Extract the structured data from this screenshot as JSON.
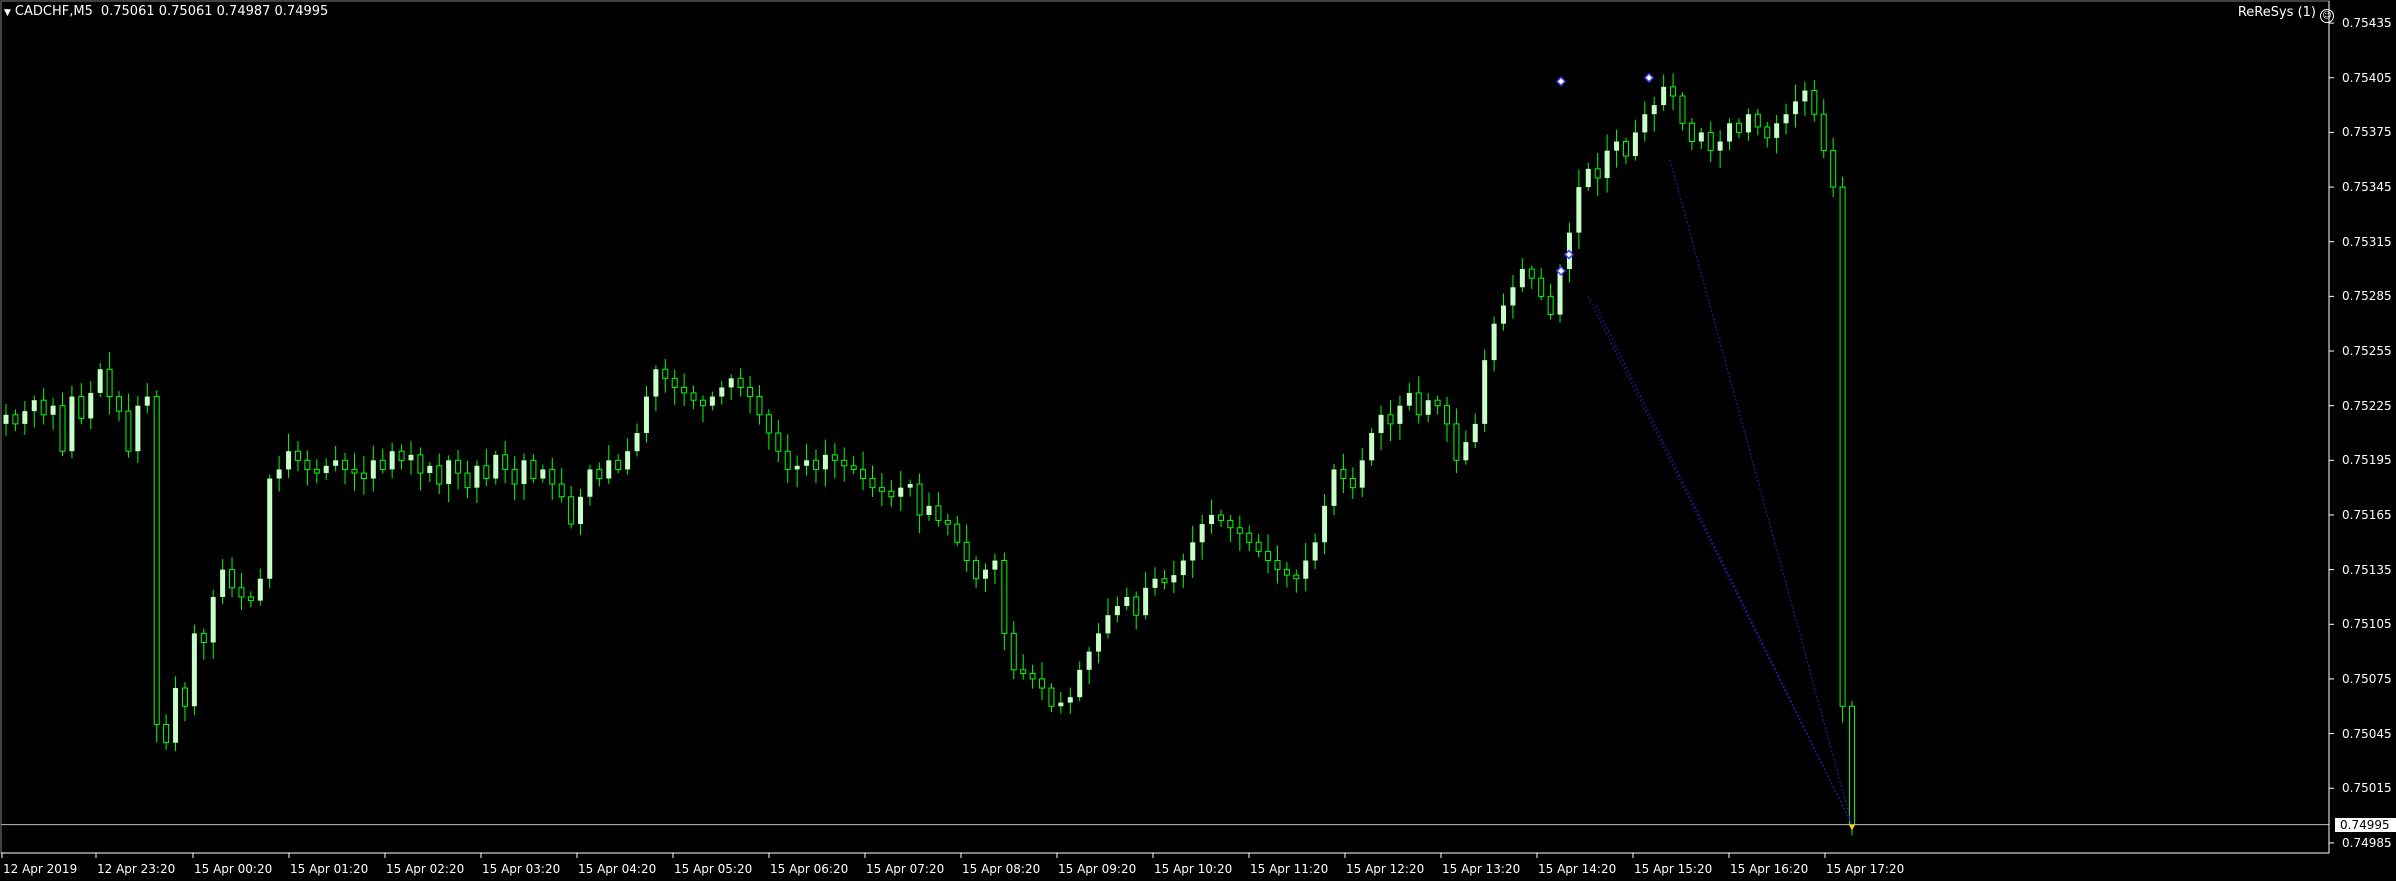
{
  "header": {
    "menu_icon": "triangle-down-icon",
    "symbol": "CADCHF,M5",
    "ohlc": "0.75061 0.75061 0.74987 0.74995"
  },
  "expert": {
    "label": "ReReSys (1)",
    "icon": "smiley-icon"
  },
  "price_axis": {
    "ticks": [
      "0.75435",
      "0.75405",
      "0.75375",
      "0.75345",
      "0.75315",
      "0.75285",
      "0.75255",
      "0.75225",
      "0.75195",
      "0.75165",
      "0.75135",
      "0.75105",
      "0.75075",
      "0.75045",
      "0.75015",
      "0.74985"
    ],
    "bid": "0.74995"
  },
  "time_axis": {
    "ticks": [
      "12 Apr 2019",
      "12 Apr 23:20",
      "15 Apr 00:20",
      "15 Apr 01:20",
      "15 Apr 02:20",
      "15 Apr 03:20",
      "15 Apr 04:20",
      "15 Apr 05:20",
      "15 Apr 06:20",
      "15 Apr 07:20",
      "15 Apr 08:20",
      "15 Apr 09:20",
      "15 Apr 10:20",
      "15 Apr 11:20",
      "15 Apr 12:20",
      "15 Apr 13:20",
      "15 Apr 14:20",
      "15 Apr 15:20",
      "15 Apr 16:20",
      "15 Apr 17:20"
    ]
  },
  "colors": {
    "background": "#000000",
    "bull_candle": "#c8ffc8",
    "wick": "#00ff00",
    "text": "#ffffff",
    "trend_line": "#1e1e9a",
    "marker": "#4040ff"
  },
  "chart_data": {
    "type": "candlestick",
    "symbol": "CADCHF",
    "timeframe": "M5",
    "ylim": [
      0.7498,
      0.7544
    ],
    "close_series": [
      0.7522,
      0.75215,
      0.75222,
      0.75228,
      0.7522,
      0.75225,
      0.752,
      0.7523,
      0.75218,
      0.75232,
      0.75245,
      0.7523,
      0.75222,
      0.752,
      0.75225,
      0.7523,
      0.7505,
      0.7504,
      0.7507,
      0.7506,
      0.751,
      0.75095,
      0.7512,
      0.75135,
      0.75125,
      0.7512,
      0.75118,
      0.7513,
      0.75185,
      0.7519,
      0.752,
      0.75195,
      0.7519,
      0.75188,
      0.75192,
      0.75195,
      0.7519,
      0.75188,
      0.75185,
      0.75195,
      0.7519,
      0.752,
      0.75195,
      0.75198,
      0.75188,
      0.75192,
      0.75182,
      0.75195,
      0.75188,
      0.7518,
      0.75192,
      0.75185,
      0.75198,
      0.7519,
      0.75182,
      0.75195,
      0.75185,
      0.7519,
      0.75182,
      0.75175,
      0.7516,
      0.75175,
      0.7519,
      0.75185,
      0.75195,
      0.7519,
      0.752,
      0.7521,
      0.7523,
      0.75245,
      0.7524,
      0.75235,
      0.75232,
      0.75228,
      0.75225,
      0.7523,
      0.75235,
      0.7524,
      0.75235,
      0.7523,
      0.7522,
      0.7521,
      0.752,
      0.7519,
      0.75192,
      0.75195,
      0.7519,
      0.75198,
      0.75195,
      0.75192,
      0.7519,
      0.75185,
      0.7518,
      0.75178,
      0.75175,
      0.7518,
      0.75182,
      0.75165,
      0.7517,
      0.75162,
      0.7516,
      0.7515,
      0.7514,
      0.7513,
      0.75135,
      0.7514,
      0.751,
      0.7508,
      0.75078,
      0.75075,
      0.7507,
      0.7506,
      0.75062,
      0.75065,
      0.7508,
      0.7509,
      0.751,
      0.7511,
      0.75115,
      0.7512,
      0.7511,
      0.75125,
      0.7513,
      0.75128,
      0.75132,
      0.7514,
      0.7515,
      0.7516,
      0.75165,
      0.75162,
      0.75158,
      0.75155,
      0.7515,
      0.75145,
      0.7514,
      0.75135,
      0.75132,
      0.7513,
      0.7514,
      0.7515,
      0.7517,
      0.7519,
      0.75185,
      0.7518,
      0.75195,
      0.7521,
      0.7522,
      0.75215,
      0.75225,
      0.75232,
      0.7522,
      0.75228,
      0.75225,
      0.75215,
      0.75195,
      0.75205,
      0.75215,
      0.7525,
      0.7527,
      0.7528,
      0.7529,
      0.753,
      0.75295,
      0.75285,
      0.75275,
      0.753,
      0.7532,
      0.75345,
      0.75355,
      0.7535,
      0.75365,
      0.7537,
      0.75362,
      0.75375,
      0.75385,
      0.7539,
      0.754,
      0.75395,
      0.7538,
      0.7537,
      0.75375,
      0.75365,
      0.7537,
      0.7538,
      0.75375,
      0.75385,
      0.75378,
      0.75372,
      0.7538,
      0.75385,
      0.75392,
      0.75398,
      0.75385,
      0.75365,
      0.75345,
      0.7506,
      0.74995
    ],
    "annotations": [
      "diamond markers at swing highs",
      "dotted trend lines converging to current price"
    ]
  }
}
